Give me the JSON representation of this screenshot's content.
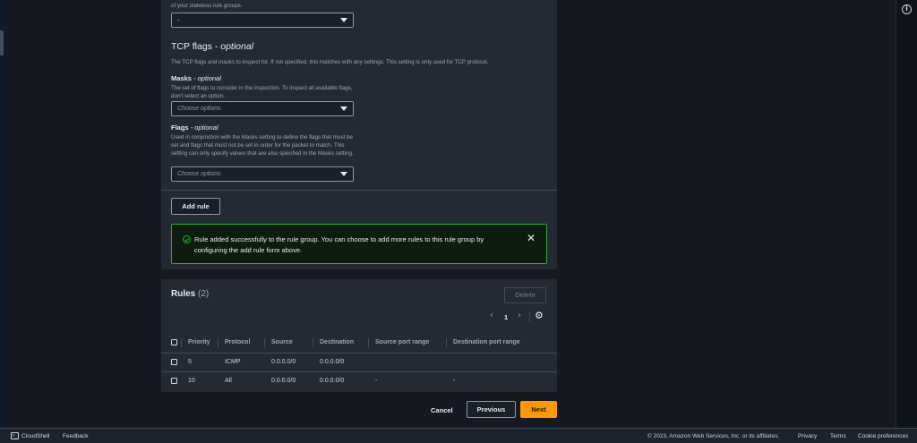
{
  "top_select": {
    "desc": "of your stateless rule groups.",
    "value": "-"
  },
  "tcp_flags": {
    "heading": "TCP flags",
    "heading_suffix": "- optional",
    "desc": "The TCP flags and masks to inspect for. If not specified, this matches with any settings. This setting is only used for TCP protocol."
  },
  "masks": {
    "label": "Masks",
    "label_suffix": "- optional",
    "desc": "The set of flags to consider in the inspection. To inspect all available flags, don't select an option.",
    "placeholder": "Choose options"
  },
  "flags": {
    "label": "Flags",
    "label_suffix": "- optional",
    "desc": "Used in conjunction with the Masks setting to define the flags that must be set and flags that must not be set in order for the packet to match. This setting can only specify values that are also specified in the Masks setting.",
    "placeholder": "Choose options"
  },
  "add_rule_label": "Add rule",
  "flash": {
    "message": "Rule added successfully to the rule group. You can choose to add more rules to this rule group by configuring the add rule form above."
  },
  "rules": {
    "title": "Rules",
    "count": "(2)",
    "delete_label": "Delete",
    "page": "1",
    "columns": [
      "Priority",
      "Protocol",
      "Source",
      "Destination",
      "Source port range",
      "Destination port range"
    ],
    "rows": [
      [
        "5",
        "ICMP",
        "0.0.0.0/0",
        "0.0.0.0/0",
        "",
        ""
      ],
      [
        "10",
        "All",
        "0.0.0.0/0",
        "0.0.0.0/0",
        "-",
        "-"
      ]
    ]
  },
  "actions": {
    "cancel": "Cancel",
    "previous": "Previous",
    "next": "Next"
  },
  "footer": {
    "cloudshell": "CloudShell",
    "feedback": "Feedback",
    "copyright": "© 2023, Amazon Web Services, Inc. or its affiliates.",
    "privacy": "Privacy",
    "terms": "Terms",
    "cookies": "Cookie preferences"
  },
  "colors": {
    "accent": "#ff9900",
    "success": "#29ad32",
    "background": "#16191f"
  },
  "icons": [
    "info-icon",
    "check-circle-icon",
    "close-icon",
    "chevron-left-icon",
    "chevron-right-icon",
    "gear-icon",
    "cloudshell-icon"
  ]
}
